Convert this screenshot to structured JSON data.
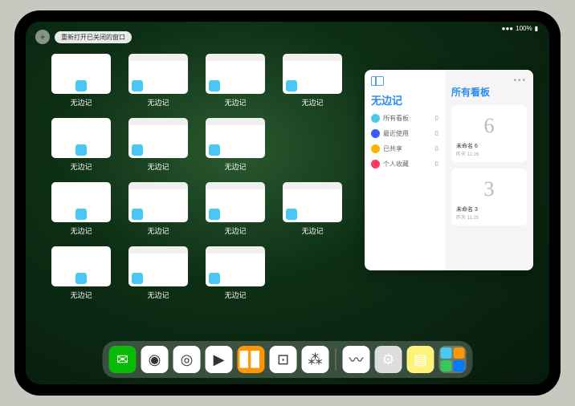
{
  "statusbar": {
    "signal": "●●●",
    "battery": "100%"
  },
  "controls": {
    "add": "+",
    "reopen": "重新打开已关闭的窗口"
  },
  "appLabel": "无边记",
  "windowTypes": [
    "blank",
    "board",
    "board",
    "board",
    "blank",
    "board",
    "board",
    "",
    "blank",
    "board",
    "board",
    "board",
    "blank",
    "board",
    "board",
    ""
  ],
  "freeform": {
    "title": "无边记",
    "mainTitle": "所有看板",
    "categories": [
      {
        "label": "所有看板",
        "count": "0",
        "color": "#4ac8f0"
      },
      {
        "label": "最近使用",
        "count": "0",
        "color": "#3a5cff"
      },
      {
        "label": "已共享",
        "count": "0",
        "color": "#ffb400"
      },
      {
        "label": "个人收藏",
        "count": "0",
        "color": "#ff3b5c"
      }
    ],
    "boards": [
      {
        "sketch": "6",
        "name": "未命名 6",
        "date": "昨天 11:26"
      },
      {
        "sketch": "3",
        "name": "未命名 3",
        "date": "昨天 11:25"
      }
    ]
  },
  "dock": [
    {
      "name": "wechat",
      "bg": "#09bb07",
      "glyph": "✉"
    },
    {
      "name": "quark",
      "bg": "#fff",
      "glyph": "◉"
    },
    {
      "name": "quark-hd",
      "bg": "#fff",
      "glyph": "◎"
    },
    {
      "name": "play",
      "bg": "#fff",
      "glyph": "▶"
    },
    {
      "name": "books",
      "bg": "#ff9500",
      "glyph": "▊▊"
    },
    {
      "name": "dice",
      "bg": "#fff",
      "glyph": "⊡"
    },
    {
      "name": "atoms",
      "bg": "#fff",
      "glyph": "⁂"
    },
    {
      "name": "freeform",
      "bg": "#fff",
      "glyph": "〰"
    },
    {
      "name": "settings",
      "bg": "#ddd",
      "glyph": "⚙"
    },
    {
      "name": "notes",
      "bg": "#fff27a",
      "glyph": "▤"
    }
  ]
}
